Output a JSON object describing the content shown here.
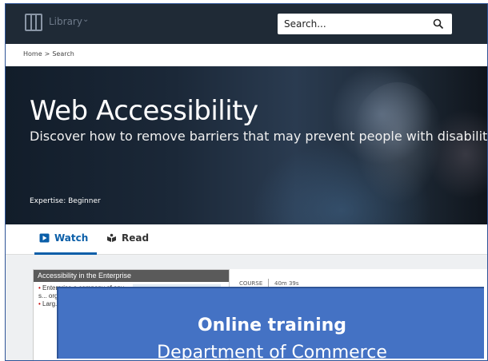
{
  "header": {
    "library_label": "Library",
    "search_placeholder": "Search..."
  },
  "breadcrumb": {
    "home": "Home",
    "separator": ">",
    "current": "Search"
  },
  "hero": {
    "title": "Web Accessibility",
    "subtitle": "Discover how to remove barriers that may prevent people with disabilities from us",
    "expertise": "Expertise: Beginner"
  },
  "tabs": [
    {
      "label": "Watch",
      "icon": "play-icon",
      "active": true
    },
    {
      "label": "Read",
      "icon": "book-icon",
      "active": false
    }
  ],
  "course_card": {
    "thumbnail_title": "Accessibility in the Enterprise",
    "thumbnail_bullets": [
      "Enterprise a company of any s... orga",
      "Larg... have"
    ],
    "type": "COURSE",
    "duration": "40m 39s"
  },
  "overlay": {
    "title": "Online training",
    "subtitle": "Department of Commerce"
  },
  "colors": {
    "topbar": "#1f2a36",
    "accent": "#0a5ea8",
    "overlay": "#4472c4",
    "frame": "#2f5597"
  }
}
